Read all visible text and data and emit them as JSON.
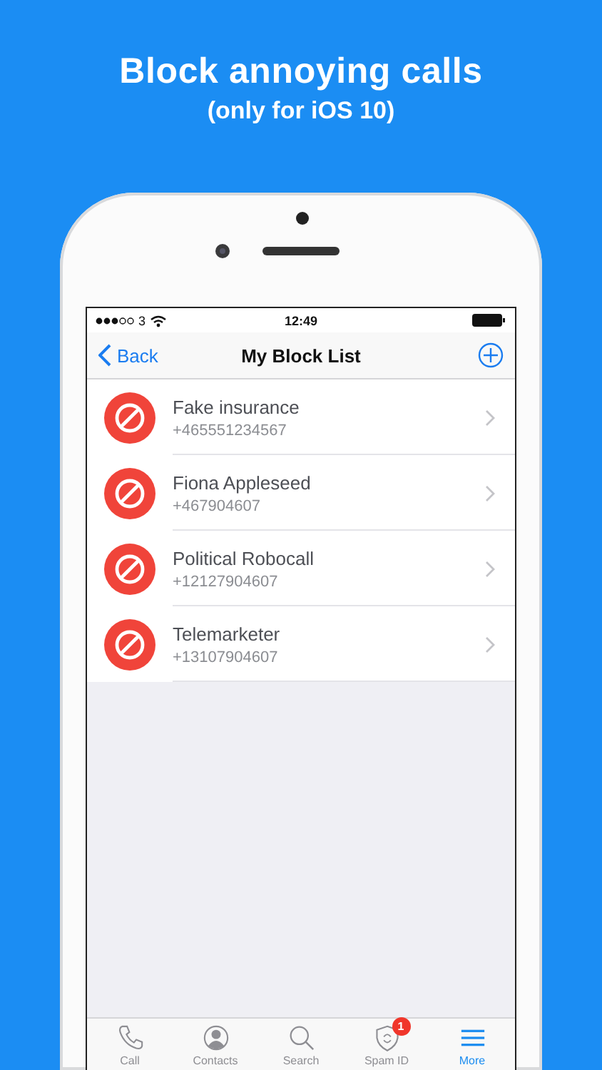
{
  "headline": "Block annoying calls",
  "subheadline": "(only for iOS 10)",
  "status_bar": {
    "carrier": "3",
    "time": "12:49"
  },
  "nav": {
    "back": "Back",
    "title": "My Block List"
  },
  "blocked": [
    {
      "name": "Fake insurance",
      "number": "+465551234567"
    },
    {
      "name": "Fiona Appleseed",
      "number": "+467904607"
    },
    {
      "name": "Political Robocall",
      "number": "+12127904607"
    },
    {
      "name": "Telemarketer",
      "number": "+13107904607"
    }
  ],
  "tabs": [
    {
      "label": "Call",
      "kind": "phone",
      "selected": false
    },
    {
      "label": "Contacts",
      "kind": "contact",
      "selected": false
    },
    {
      "label": "Search",
      "kind": "search",
      "selected": false
    },
    {
      "label": "Spam ID",
      "kind": "shield",
      "selected": false,
      "badge": "1"
    },
    {
      "label": "More",
      "kind": "menu",
      "selected": true
    }
  ]
}
